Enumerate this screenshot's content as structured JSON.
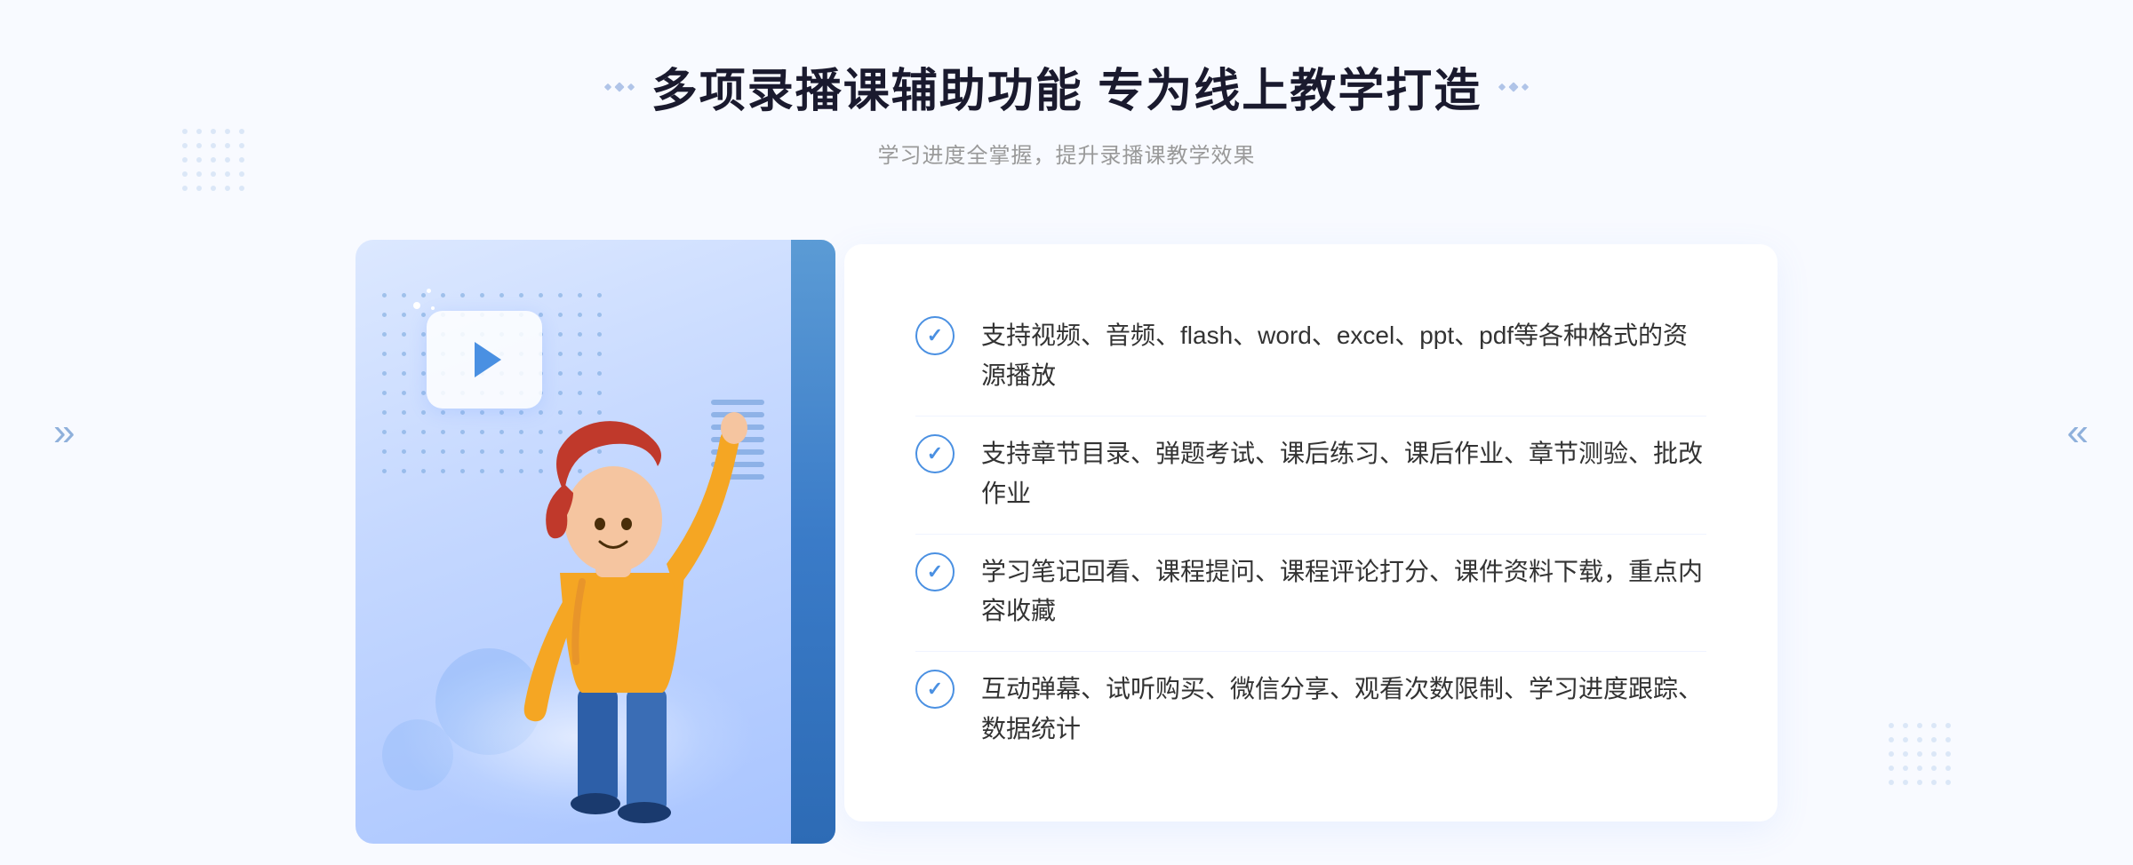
{
  "header": {
    "title": "多项录播课辅助功能 专为线上教学打造",
    "subtitle": "学习进度全掌握，提升录播课教学效果"
  },
  "decorators": {
    "left_arrows": "»",
    "right_arrows": "«"
  },
  "features": [
    {
      "id": 1,
      "text": "支持视频、音频、flash、word、excel、ppt、pdf等各种格式的资源播放"
    },
    {
      "id": 2,
      "text": "支持章节目录、弹题考试、课后练习、课后作业、章节测验、批改作业"
    },
    {
      "id": 3,
      "text": "学习笔记回看、课程提问、课程评论打分、课件资料下载，重点内容收藏"
    },
    {
      "id": 4,
      "text": "互动弹幕、试听购买、微信分享、观看次数限制、学习进度跟踪、数据统计"
    }
  ]
}
